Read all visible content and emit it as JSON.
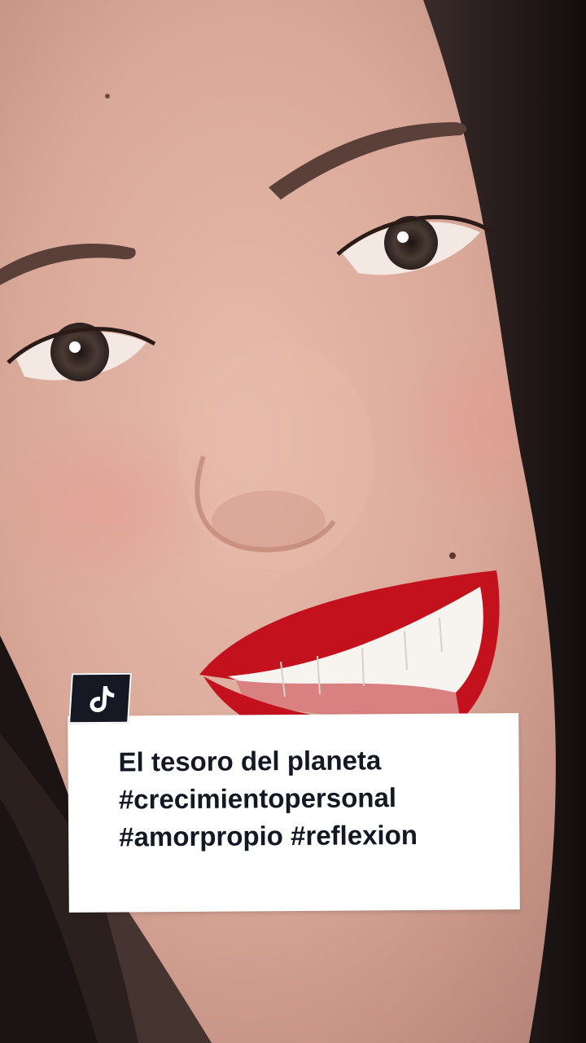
{
  "app": {
    "name": "TikTok"
  },
  "overlay": {
    "icon": "tiktok-logo-icon",
    "caption_lines": [
      "El tesoro del planeta",
      "#crecimientopersonal",
      "#amorpropio #reflexion"
    ]
  },
  "colors": {
    "card_bg": "#ffffff",
    "caption_text": "#141823",
    "badge_bg": "#161823",
    "lip_red": "#c3121e"
  }
}
